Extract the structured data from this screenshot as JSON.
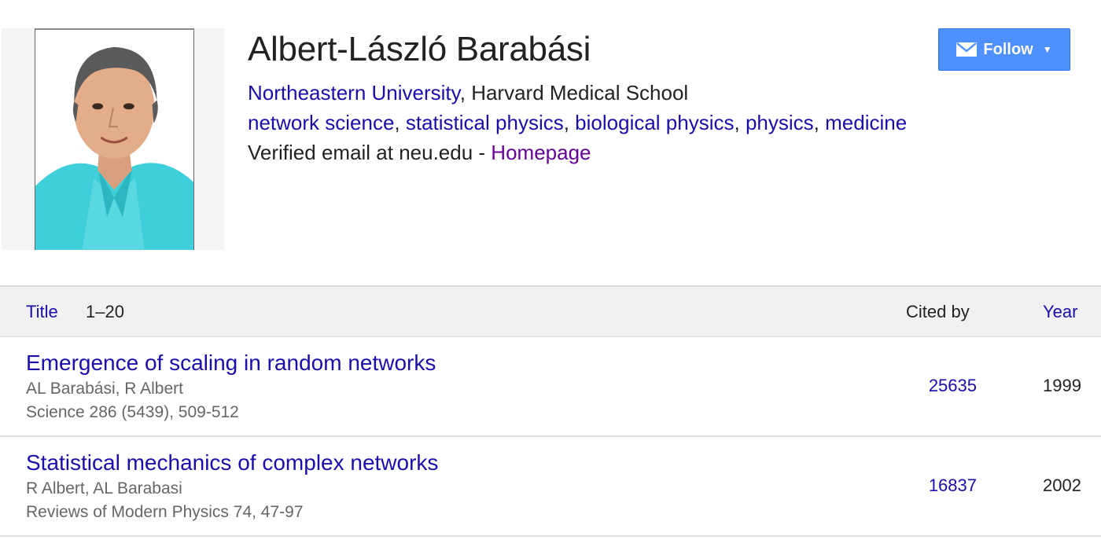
{
  "profile": {
    "name": "Albert-László Barabási",
    "affiliation_link": "Northeastern University",
    "affiliation_sep": ", ",
    "affiliation_rest": "Harvard Medical School",
    "interests": [
      "network science",
      "statistical physics",
      "biological physics",
      "physics",
      "medicine"
    ],
    "interest_sep": ", ",
    "email_text": "Verified email at neu.edu - ",
    "homepage_label": "Homepage"
  },
  "follow": {
    "label": "Follow",
    "icon": "envelope-icon",
    "caret": "▼",
    "color": "#4d90fe"
  },
  "table": {
    "header": {
      "title": "Title",
      "range": "1–20",
      "cited_by": "Cited by",
      "year": "Year"
    },
    "rows": [
      {
        "title": "Emergence of scaling in random networks",
        "authors": "AL Barabási, R Albert",
        "venue": "Science 286 (5439), 509-512",
        "cited_by": "25635",
        "year": "1999"
      },
      {
        "title": "Statistical mechanics of complex networks",
        "authors": "R Albert, AL Barabasi",
        "venue": "Reviews of Modern Physics 74, 47-97",
        "cited_by": "16837",
        "year": "2002"
      }
    ]
  },
  "colors": {
    "link": "#1a0dab",
    "visited": "#660099",
    "muted": "#666666"
  }
}
